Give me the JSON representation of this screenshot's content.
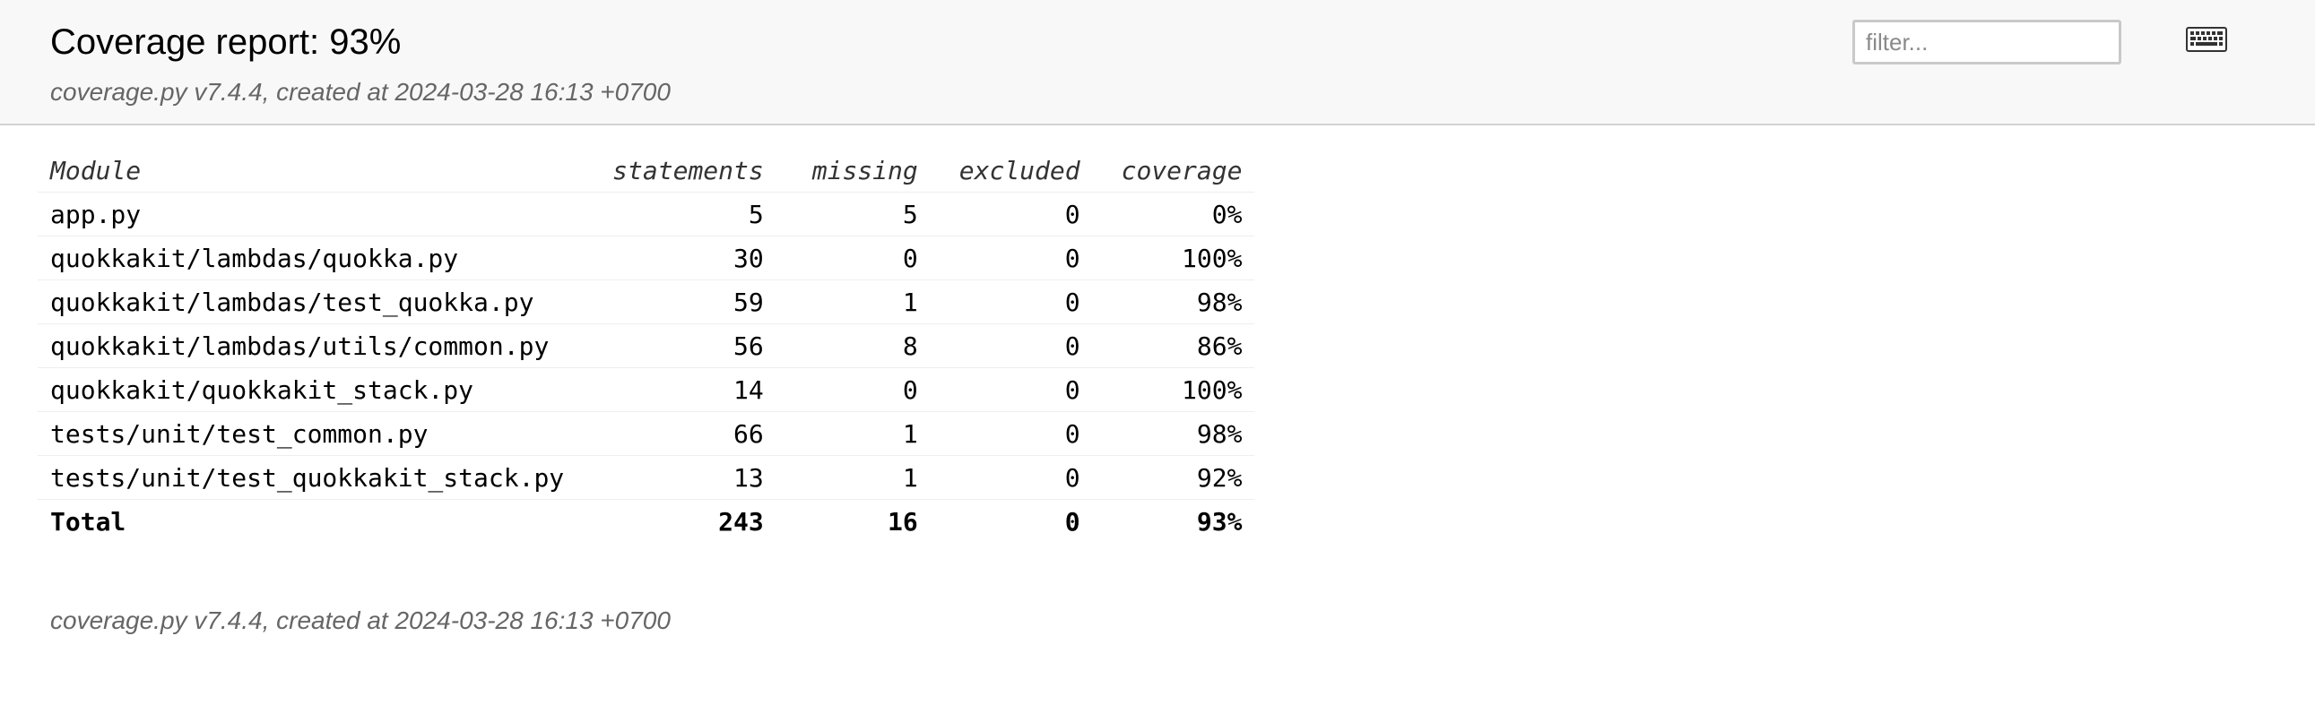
{
  "header": {
    "title": "Coverage report: 93%",
    "subtitle": "coverage.py v7.4.4, created at 2024-03-28 16:13 +0700",
    "filter_placeholder": "filter...",
    "keyboard_icon": "keyboard-icon"
  },
  "table": {
    "columns": {
      "module": "Module",
      "statements": "statements",
      "missing": "missing",
      "excluded": "excluded",
      "coverage": "coverage"
    },
    "rows": [
      {
        "module": "app.py",
        "statements": "5",
        "missing": "5",
        "excluded": "0",
        "coverage": "0%"
      },
      {
        "module": "quokkakit/lambdas/quokka.py",
        "statements": "30",
        "missing": "0",
        "excluded": "0",
        "coverage": "100%"
      },
      {
        "module": "quokkakit/lambdas/test_quokka.py",
        "statements": "59",
        "missing": "1",
        "excluded": "0",
        "coverage": "98%"
      },
      {
        "module": "quokkakit/lambdas/utils/common.py",
        "statements": "56",
        "missing": "8",
        "excluded": "0",
        "coverage": "86%"
      },
      {
        "module": "quokkakit/quokkakit_stack.py",
        "statements": "14",
        "missing": "0",
        "excluded": "0",
        "coverage": "100%"
      },
      {
        "module": "tests/unit/test_common.py",
        "statements": "66",
        "missing": "1",
        "excluded": "0",
        "coverage": "98%"
      },
      {
        "module": "tests/unit/test_quokkakit_stack.py",
        "statements": "13",
        "missing": "1",
        "excluded": "0",
        "coverage": "92%"
      }
    ],
    "total": {
      "module": "Total",
      "statements": "243",
      "missing": "16",
      "excluded": "0",
      "coverage": "93%"
    }
  },
  "footer": {
    "text": "coverage.py v7.4.4, created at 2024-03-28 16:13 +0700"
  }
}
